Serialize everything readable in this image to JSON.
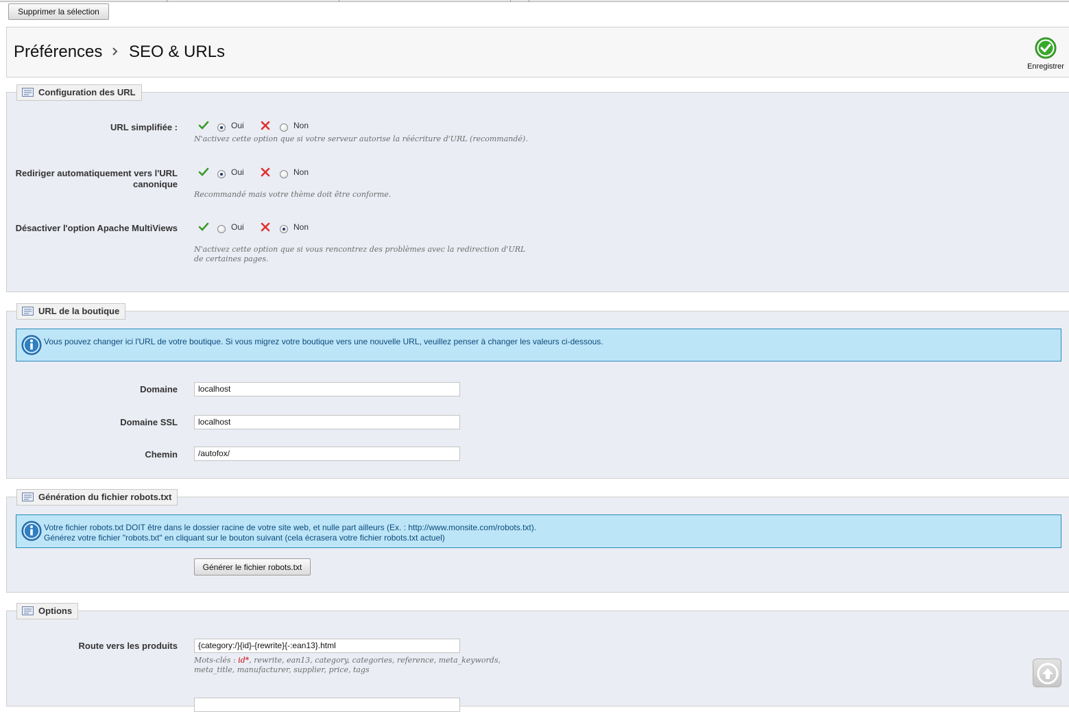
{
  "toolbar": {
    "delete_selection_label": "Supprimer la sélection",
    "save_label": "Enregistrer"
  },
  "breadcrumb": {
    "parent": "Préférences",
    "current": "SEO & URLs"
  },
  "url_config": {
    "legend": "Configuration des URL",
    "fields": [
      {
        "label": "URL simplifiée :",
        "yes": "Oui",
        "no": "Non",
        "selected": "yes",
        "hint": "N'activez cette option que si votre serveur autorise la réécriture d'URL (recommandé)."
      },
      {
        "label": "Rediriger automatiquement vers l'URL canonique",
        "yes": "Oui",
        "no": "Non",
        "selected": "yes",
        "hint": "Recommandé mais votre thème doit être conforme."
      },
      {
        "label": "Désactiver l'option Apache MultiViews",
        "yes": "Oui",
        "no": "Non",
        "selected": "no",
        "hint": "N'activez cette option que si vous rencontrez des problèmes avec la redirection d'URL de certaines pages."
      }
    ]
  },
  "shop_url": {
    "legend": "URL de la boutique",
    "info": "Vous pouvez changer ici l'URL de votre boutique. Si vous migrez votre boutique vers une nouvelle URL, veuillez penser à changer les valeurs ci-dessous.",
    "domain_label": "Domaine",
    "domain_value": "localhost",
    "ssl_label": "Domaine SSL",
    "ssl_value": "localhost",
    "path_label": "Chemin",
    "path_value": "/autofox/"
  },
  "robots": {
    "legend": "Génération du fichier robots.txt",
    "info_line1": "Votre fichier robots.txt DOIT être dans le dossier racine de votre site web, et nulle part ailleurs (Ex. : http://www.monsite.com/robots.txt).",
    "info_line2": "Générez votre fichier \"robots.txt\" en cliquant sur le bouton suivant (cela écrasera votre fichier robots.txt actuel)",
    "button_label": "Générer le fichier robots.txt"
  },
  "options": {
    "legend": "Options",
    "product_route_label": "Route vers les produits",
    "product_route_value": "{category:/}{id}-{rewrite}{-:ean13}.html",
    "keywords_prefix": "Mots-clés : ",
    "keywords_required": "id*",
    "keywords_rest": ", rewrite, ean13, category, categories, reference, meta_keywords, meta_title, manufacturer, supplier, price, tags"
  },
  "colors": {
    "panel_bg": "#ebedf4",
    "info_bg": "#bde5f8",
    "info_border": "#2a8ab9",
    "ok_green": "#3a9a2a",
    "ko_red": "#e03030"
  }
}
